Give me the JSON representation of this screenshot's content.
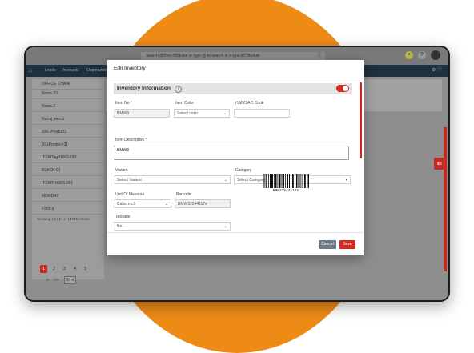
{
  "topbar": {
    "search_placeholder": "Search across modules or type @ to search in a specific module"
  },
  "nav": {
    "items": [
      "Leads",
      "Accounts",
      "Opportunities"
    ]
  },
  "left_list": {
    "header_item": "OFFICE CHAIR",
    "items": [
      "Nokia 20",
      "Nokia 2",
      "Natraj pencil",
      "SRL-Product1",
      "BIGProduct-01",
      "ITEMTagHURS-001",
      "BLACK-01",
      "ITEMTHURS-001",
      "MONDAY",
      "Fans-q"
    ],
    "pager_info": "Showing 1 to 10 of 14729 entries",
    "pages": [
      "1",
      "2",
      "3",
      "4",
      "5"
    ],
    "per_page": "10"
  },
  "modal": {
    "title": "Edit Inventory",
    "section_title": "Inventory Information",
    "fields": {
      "item_no": {
        "label": "Item No",
        "value": "BMW3"
      },
      "item_color": {
        "label": "Item Color",
        "value": "Select color"
      },
      "hsn": {
        "label": "HSN/SAC Code",
        "value": ""
      },
      "item_description": {
        "label": "Item Description",
        "value": "BMW3"
      },
      "variant": {
        "label": "Variant",
        "value": "Select Variant"
      },
      "category": {
        "label": "Category",
        "value": "Select Category"
      },
      "unit_of_measure": {
        "label": "Unit Of Measure",
        "value": "Cubic inch"
      },
      "barcode": {
        "label": "Barcode",
        "value": "BMW32544117e"
      },
      "towable": {
        "label": "Towable",
        "value": "No"
      }
    },
    "barcode_text": "BMW32544117e",
    "cancel_label": "Cancel",
    "save_label": "Save"
  },
  "colors": {
    "accent": "#d42a22",
    "background_circle": "#ee8b17",
    "nav_bg": "#1e2f3e"
  }
}
